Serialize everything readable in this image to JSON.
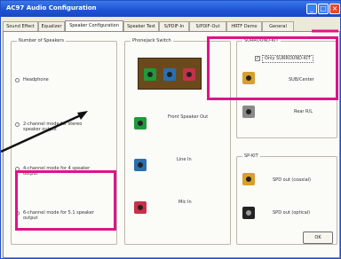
{
  "window": {
    "title": "AC97 Audio Configuration",
    "minimize_glyph": "_",
    "maximize_glyph": "□",
    "close_glyph": "×"
  },
  "tabs": [
    {
      "label": "Sound Effect"
    },
    {
      "label": "Equalizer"
    },
    {
      "label": "Speaker Configuration"
    },
    {
      "label": "Speaker Test"
    },
    {
      "label": "S/PDIF-In"
    },
    {
      "label": "S/PDIF-Out"
    },
    {
      "label": "HRTF Demo"
    },
    {
      "label": "General"
    }
  ],
  "speakers": {
    "title": "Number of Speakers",
    "options": [
      {
        "label": "Headphone",
        "checked": false
      },
      {
        "label": "2-channel mode for stereo speaker output",
        "checked": false
      },
      {
        "label": "4-channel mode for 4 speaker output",
        "checked": false
      },
      {
        "label": "6-channel mode for 5.1 speaker output",
        "checked": true
      }
    ]
  },
  "phonejack": {
    "title": "Phonejack Switch",
    "items": [
      {
        "label": "Front Speaker Out",
        "color": "green"
      },
      {
        "label": "Line In",
        "color": "blue"
      },
      {
        "label": "Mic In",
        "color": "pink"
      }
    ]
  },
  "surround": {
    "title": "SURROUND-KIT",
    "checkbox_label": "Only SURROUND-KIT",
    "checkbox_checked": true,
    "items": [
      {
        "label": "SUB/Center",
        "color": "orange"
      },
      {
        "label": "Rear R/L",
        "color": "gray"
      }
    ]
  },
  "spkit": {
    "title": "SP-KIT",
    "items": [
      {
        "label": "SPD out (coaxial)",
        "color": "orange"
      },
      {
        "label": "SPD out (optical)",
        "color": "black"
      }
    ]
  },
  "ok_label": "OK",
  "colors": {
    "titlebar": "#1c52d4",
    "highlight": "#e0128a",
    "panel": "#fbfbf8",
    "window": "#ece9d8"
  }
}
